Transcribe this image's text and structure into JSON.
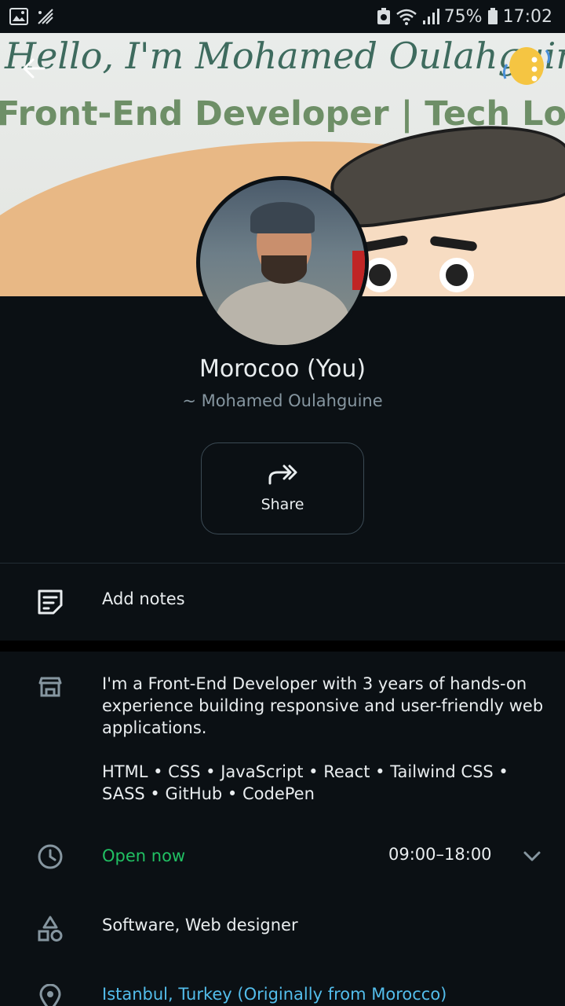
{
  "status_bar": {
    "battery": "75%",
    "time": "17:02"
  },
  "cover": {
    "line1": "Hello, I'm Mohamed Oulahguine",
    "line2": "Front-End Developer | Tech Lover"
  },
  "profile": {
    "name": "Morocoo (You)",
    "subname": "~ Mohamed Oulahguine"
  },
  "actions": {
    "share_label": "Share"
  },
  "notes": {
    "label": "Add notes"
  },
  "business": {
    "about": "I'm a Front-End Developer with 3  years of hands-on experience building responsive and user-friendly web applications.",
    "skills": "HTML • CSS • JavaScript • React • Tailwind CSS • SASS • GitHub • CodePen",
    "status": "Open now",
    "hours": "09:00–18:00",
    "category": "Software, Web designer",
    "location": "Istanbul, Turkey (Originally from Morocco)"
  },
  "colors": {
    "background": "#0b1014",
    "open_green": "#21c063",
    "link_blue": "#53bdeb"
  }
}
